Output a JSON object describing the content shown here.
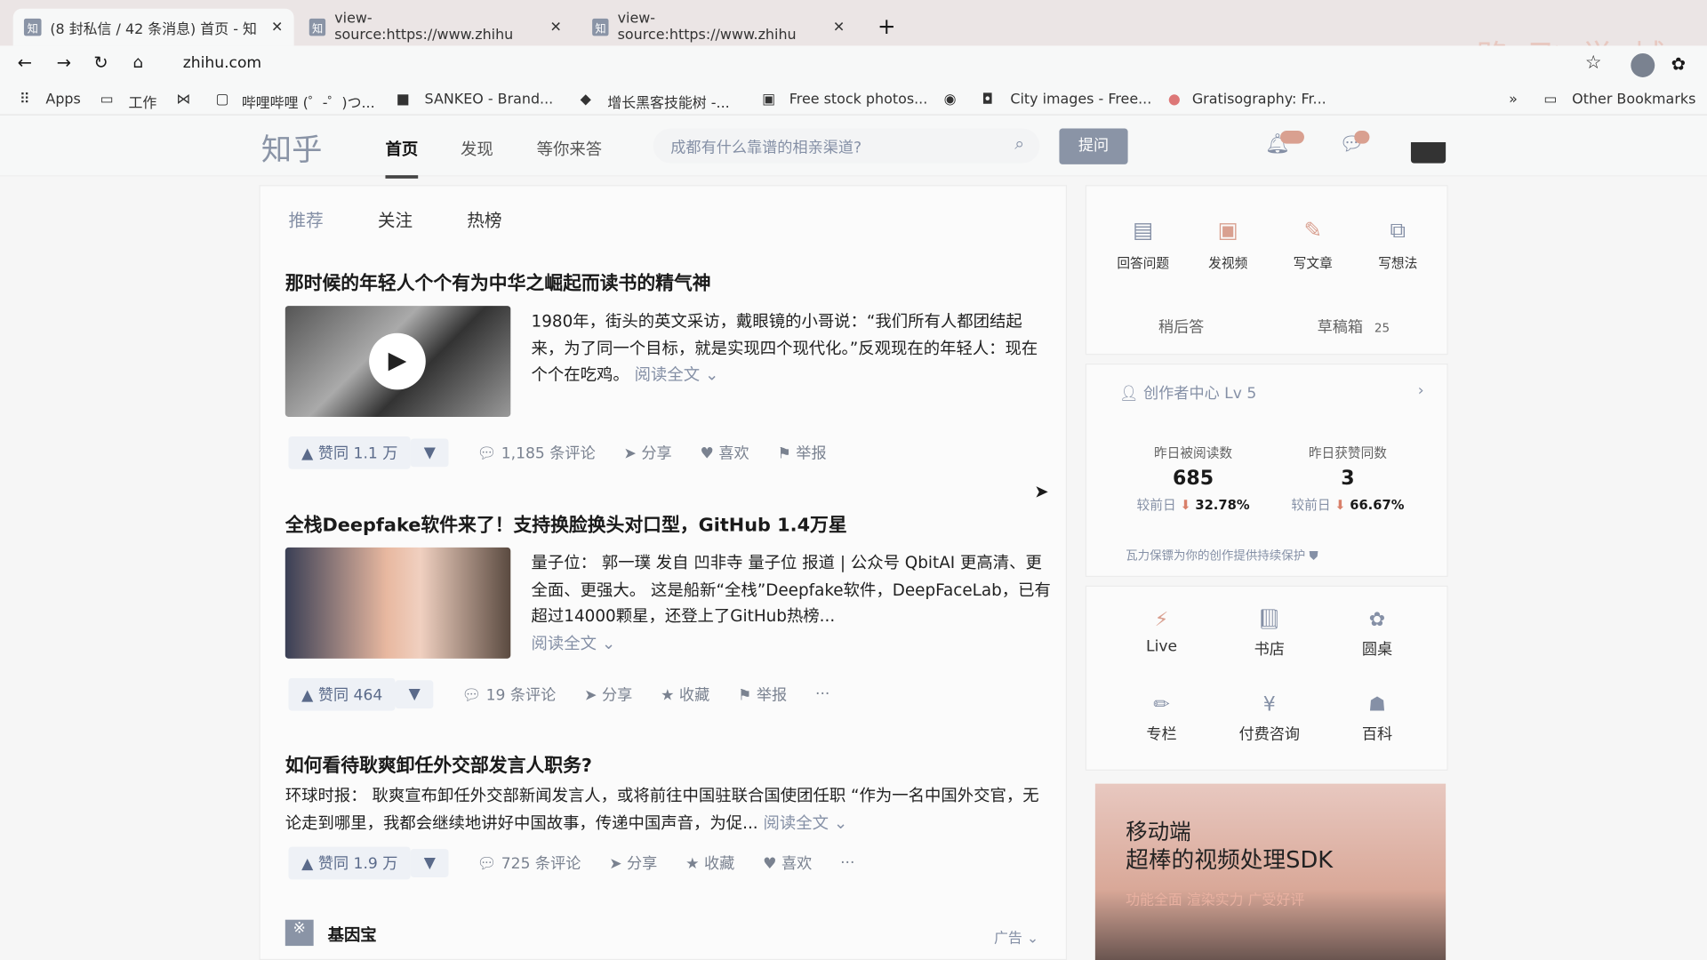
{
  "browser": {
    "tabs": [
      {
        "label": "(8 封私信 / 42 条消息) 首页 - 知"
      },
      {
        "label": "view-source:https://www.zhihu"
      },
      {
        "label": "view-source:https://www.zhihu"
      }
    ],
    "url": "zhihu.com",
    "watermark": "路飞学城",
    "bookmarks": [
      "Apps",
      "工作",
      "哔哩哔哩 (゜-゜)つ...",
      "SANKEO - Brand...",
      "增长黑客技能树 -...",
      "Free stock photos...",
      "City images - Free...",
      "Gratisography: Fr..."
    ],
    "other_bookmarks": "Other Bookmarks"
  },
  "header": {
    "logo": "知乎",
    "nav": [
      "首页",
      "发现",
      "等你来答"
    ],
    "search_placeholder": "成都有什么靠谱的相亲渠道?",
    "ask": "提问"
  },
  "feed": {
    "tabs": [
      "推荐",
      "关注",
      "热榜"
    ],
    "items": [
      {
        "title": "那时候的年轻人个个有为中华之崛起而读书的精气神",
        "excerpt": "1980年，街头的英文采访，戴眼镜的小哥说：“我们所有人都团结起来，为了同一个目标，就是实现四个现代化。”反观现在的年轻人：现在个个在吃鸡。",
        "read_more": "阅读全文",
        "vote": "赞同 1.1 万",
        "comments": "1,185 条评论",
        "share": "分享",
        "third": "喜欢",
        "report": "举报"
      },
      {
        "title": "全栈Deepfake软件来了！支持换脸换头对口型，GitHub 1.4万星",
        "excerpt": "量子位： 郭一璞 发自 凹非寺 量子位 报道 | 公众号 QbitAI 更高清、更全面、更强大。 这是船新“全栈”Deepfake软件，DeepFaceLab，已有超过14000颗星，还登上了GitHub热榜...",
        "read_more": "阅读全文",
        "vote": "赞同 464",
        "comments": "19 条评论",
        "share": "分享",
        "third": "收藏",
        "report": "举报",
        "more": "···"
      },
      {
        "title": "如何看待耿爽卸任外交部发言人职务?",
        "excerpt_source": "环球时报：",
        "excerpt": "耿爽宣布卸任外交部新闻发言人，或将前往中国驻联合国使团任职 “作为一名中国外交官，无论走到哪里，我都会继续地讲好中国故事，传递中国声音，为促...",
        "read_more": "阅读全文",
        "vote": "赞同 1.9 万",
        "comments": "725 条评论",
        "share": "分享",
        "third": "收藏",
        "fourth": "喜欢",
        "more": "···"
      }
    ],
    "ad": {
      "name": "基因宝",
      "label": "广告"
    }
  },
  "sidebar": {
    "create": [
      "回答问题",
      "发视频",
      "写文章",
      "写想法"
    ],
    "later": "稍后答",
    "drafts": "草稿箱",
    "drafts_count": "25",
    "creator": "创作者中心",
    "level": "Lv 5",
    "stats": [
      {
        "label": "昨日被阅读数",
        "value": "685",
        "cmp": "较前日",
        "change": "32.78%"
      },
      {
        "label": "昨日获赞同数",
        "value": "3",
        "cmp": "较前日",
        "change": "66.67%"
      }
    ],
    "protect": "瓦力保镖为你的创作提供持续保护",
    "grid": [
      "Live",
      "书店",
      "圆桌",
      "专栏",
      "付费咨询",
      "百科"
    ],
    "banner": {
      "line1": "移动端",
      "line2": "超棒的视频处理SDK",
      "line3": "功能全面  渲染实力  广受好评"
    }
  }
}
